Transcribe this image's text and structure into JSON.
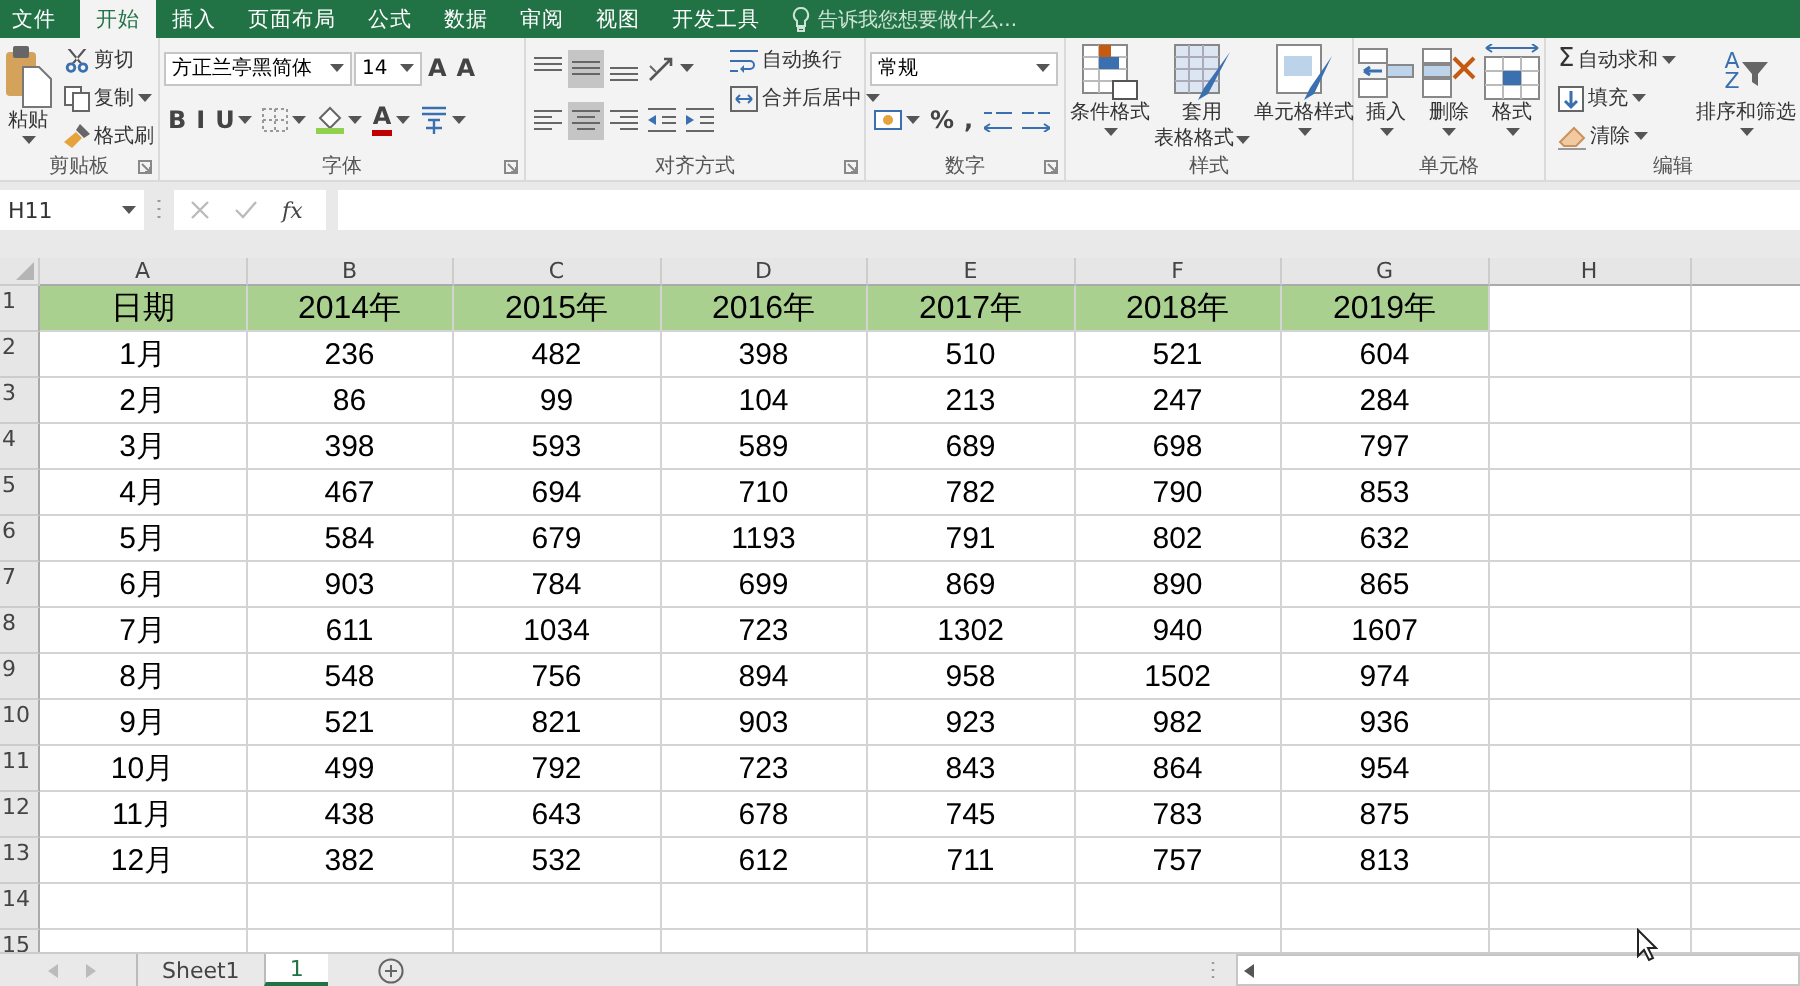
{
  "ribbon_tabs": [
    {
      "label": "文件",
      "selected": false
    },
    {
      "label": "开始",
      "selected": true
    },
    {
      "label": "插入",
      "selected": false
    },
    {
      "label": "页面布局",
      "selected": false
    },
    {
      "label": "公式",
      "selected": false
    },
    {
      "label": "数据",
      "selected": false
    },
    {
      "label": "审阅",
      "selected": false
    },
    {
      "label": "视图",
      "selected": false
    },
    {
      "label": "开发工具",
      "selected": false
    }
  ],
  "tell_me": {
    "placeholder": "告诉我您想要做什么..."
  },
  "ribbon_groups": [
    {
      "label": "剪贴板",
      "launcher": true,
      "sections": [
        {
          "kind": "large",
          "label": "粘贴",
          "dropdown": true
        },
        {
          "kind": "stack",
          "items": [
            {
              "kind": "small",
              "label": "剪切"
            },
            {
              "kind": "small",
              "label": "复制",
              "dropdown": true
            },
            {
              "kind": "small",
              "label": "格式刷"
            }
          ]
        }
      ]
    },
    {
      "label": "字体",
      "launcher": true,
      "sections": [
        {
          "kind": "rows",
          "rows": [
            {
              "items": [
                {
                  "kind": "combo",
                  "value": "方正兰亭黑简体"
                },
                {
                  "kind": "combo",
                  "value": "14"
                },
                {
                  "kind": "glyph",
                  "glyph": "A"
                },
                {
                  "kind": "glyph",
                  "glyph": "A"
                }
              ]
            },
            {
              "items": [
                {
                  "kind": "glyph",
                  "glyph": "B"
                },
                {
                  "kind": "glyph",
                  "glyph": "I"
                },
                {
                  "kind": "glyph",
                  "glyph": "U",
                  "dropdown": true
                },
                {
                  "kind": "icon",
                  "dropdown": true
                },
                {
                  "kind": "icon",
                  "dropdown": true,
                  "color": "#92d050"
                },
                {
                  "kind": "glyph",
                  "glyph": "A",
                  "dropdown": true,
                  "color": "#c00000"
                },
                {
                  "kind": "icon",
                  "dropdown": true
                }
              ]
            }
          ]
        }
      ]
    },
    {
      "label": "对齐方式",
      "launcher": true,
      "sections": [
        {
          "kind": "rows",
          "rows": [
            {
              "items": [
                {
                  "kind": "icon",
                  "selected": false
                },
                {
                  "kind": "icon",
                  "selected": true
                },
                {
                  "kind": "icon",
                  "selected": false
                },
                {
                  "kind": "icon",
                  "dropdown": true
                }
              ]
            },
            {
              "items": [
                {
                  "kind": "icon",
                  "selected": false
                },
                {
                  "kind": "icon",
                  "selected": true
                },
                {
                  "kind": "icon",
                  "selected": false
                },
                {
                  "kind": "icon"
                },
                {
                  "kind": "icon"
                }
              ]
            }
          ]
        },
        {
          "kind": "stack",
          "items": [
            {
              "kind": "small",
              "label": "自动换行"
            },
            {
              "kind": "small",
              "label": "合并后居中",
              "dropdown": true
            }
          ]
        }
      ]
    },
    {
      "label": "数字",
      "launcher": true,
      "sections": [
        {
          "kind": "rows",
          "rows": [
            {
              "items": [
                {
                  "kind": "combo",
                  "value": "常规"
                }
              ]
            },
            {
              "items": [
                {
                  "kind": "icon",
                  "dropdown": true
                },
                {
                  "kind": "glyph",
                  "glyph": "%"
                },
                {
                  "kind": "glyph",
                  "glyph": ","
                },
                {
                  "kind": "icon"
                },
                {
                  "kind": "icon"
                }
              ]
            }
          ]
        }
      ]
    },
    {
      "label": "样式",
      "sections": [
        {
          "kind": "large",
          "label": "条件格式",
          "dropdown": true
        },
        {
          "kind": "large",
          "label": "套用",
          "label2": "表格格式",
          "dropdown": true
        },
        {
          "kind": "large",
          "label": "单元格样式",
          "dropdown": true
        }
      ]
    },
    {
      "label": "单元格",
      "sections": [
        {
          "kind": "large",
          "label": "插入",
          "dropdown": true
        },
        {
          "kind": "large",
          "label": "删除",
          "dropdown": true
        },
        {
          "kind": "large",
          "label": "格式",
          "dropdown": true
        }
      ]
    },
    {
      "label": "编辑",
      "sections": [
        {
          "kind": "stack",
          "items": [
            {
              "kind": "small",
              "label": "自动求和",
              "glyph": "Σ",
              "dropdown": true
            },
            {
              "kind": "small",
              "label": "填充",
              "dropdown": true
            },
            {
              "kind": "small",
              "label": "清除",
              "dropdown": true
            }
          ]
        },
        {
          "kind": "large",
          "label": "排序和筛选",
          "glyph": "A\nZ",
          "dropdown": true
        }
      ]
    }
  ],
  "formula_bar": {
    "name_box": "H11",
    "function_label": "fx"
  },
  "sheet": {
    "columns": [
      "A",
      "B",
      "C",
      "D",
      "E",
      "F",
      "G",
      "H",
      ""
    ],
    "rows": [
      {
        "number": "1",
        "header": true,
        "cells": [
          "日期",
          "2014年",
          "2015年",
          "2016年",
          "2017年",
          "2018年",
          "2019年"
        ]
      },
      {
        "number": "2",
        "header": false,
        "cells": [
          "1月",
          "236",
          "482",
          "398",
          "510",
          "521",
          "604"
        ]
      },
      {
        "number": "3",
        "header": false,
        "cells": [
          "2月",
          "86",
          "99",
          "104",
          "213",
          "247",
          "284"
        ]
      },
      {
        "number": "4",
        "header": false,
        "cells": [
          "3月",
          "398",
          "593",
          "589",
          "689",
          "698",
          "797"
        ]
      },
      {
        "number": "5",
        "header": false,
        "cells": [
          "4月",
          "467",
          "694",
          "710",
          "782",
          "790",
          "853"
        ]
      },
      {
        "number": "6",
        "header": false,
        "cells": [
          "5月",
          "584",
          "679",
          "1193",
          "791",
          "802",
          "632"
        ]
      },
      {
        "number": "7",
        "header": false,
        "cells": [
          "6月",
          "903",
          "784",
          "699",
          "869",
          "890",
          "865"
        ]
      },
      {
        "number": "8",
        "header": false,
        "cells": [
          "7月",
          "611",
          "1034",
          "723",
          "1302",
          "940",
          "1607"
        ]
      },
      {
        "number": "9",
        "header": false,
        "cells": [
          "8月",
          "548",
          "756",
          "894",
          "958",
          "1502",
          "974"
        ]
      },
      {
        "number": "10",
        "header": false,
        "cells": [
          "9月",
          "521",
          "821",
          "903",
          "923",
          "982",
          "936"
        ]
      },
      {
        "number": "11",
        "header": false,
        "cells": [
          "10月",
          "499",
          "792",
          "723",
          "843",
          "864",
          "954"
        ]
      },
      {
        "number": "12",
        "header": false,
        "cells": [
          "11月",
          "438",
          "643",
          "678",
          "745",
          "783",
          "875"
        ]
      },
      {
        "number": "13",
        "header": false,
        "cells": [
          "12月",
          "382",
          "532",
          "612",
          "711",
          "757",
          "813"
        ]
      },
      {
        "number": "14",
        "header": false,
        "cells": []
      },
      {
        "number": "15",
        "header": false,
        "cells": []
      }
    ]
  },
  "sheet_tabs": [
    {
      "label": "Sheet1",
      "selected": false
    },
    {
      "label": "1",
      "selected": true
    }
  ]
}
